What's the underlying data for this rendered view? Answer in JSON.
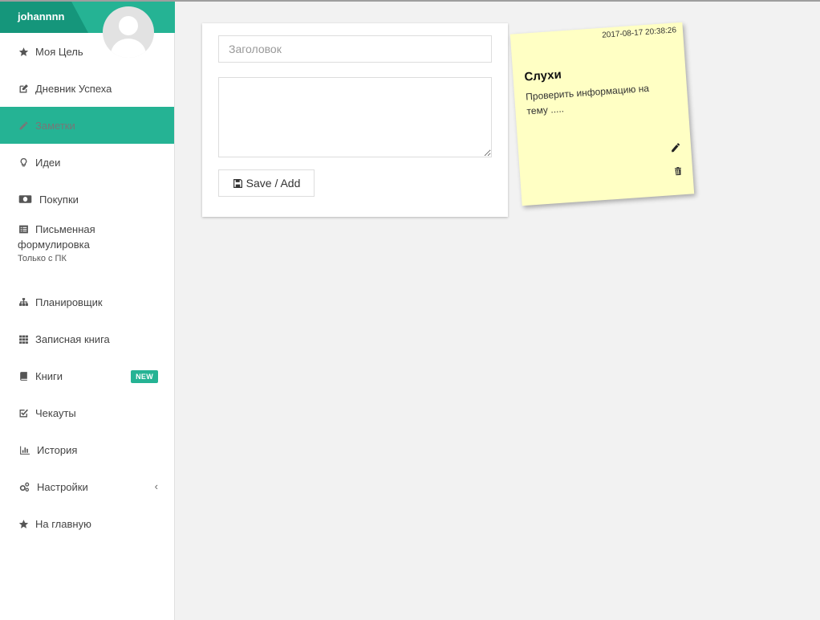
{
  "user": {
    "name": "johannnn"
  },
  "sidebar": {
    "items": [
      {
        "label": "Моя Цель",
        "icon": "star-icon"
      },
      {
        "label": "Дневник Успеха",
        "icon": "edit-icon"
      },
      {
        "label": "Заметки",
        "icon": "pencil-icon",
        "active": true
      },
      {
        "label": "Идеи",
        "icon": "lightbulb-icon"
      },
      {
        "label": "Покупки",
        "icon": "money-icon"
      },
      {
        "label": "Письменная",
        "label2": "формулировка",
        "sublabel": "Только с ПК",
        "icon": "list-alt-icon"
      },
      {
        "label": "Планировщик",
        "icon": "sitemap-icon"
      },
      {
        "label": "Записная книга",
        "icon": "grid-icon"
      },
      {
        "label": "Книги",
        "icon": "book-icon",
        "badge": "NEW"
      },
      {
        "label": "Чекауты",
        "icon": "checkbox-icon"
      },
      {
        "label": "История",
        "icon": "bar-chart-icon"
      },
      {
        "label": "Настройки",
        "icon": "cogs-icon",
        "chevron": "‹"
      },
      {
        "label": "На главную",
        "icon": "star-icon"
      }
    ]
  },
  "form": {
    "title_placeholder": "Заголовок",
    "title_value": "",
    "body_value": "",
    "save_label": "Save / Add"
  },
  "note": {
    "date": "2017-08-17 20:38:26",
    "title": "Слухи",
    "text": "Проверить информацию на тему ....."
  },
  "colors": {
    "accent": "#25b394",
    "accent_dark": "#15967b",
    "note_bg": "#ffffc4",
    "page_bg": "#f2f2f2"
  }
}
